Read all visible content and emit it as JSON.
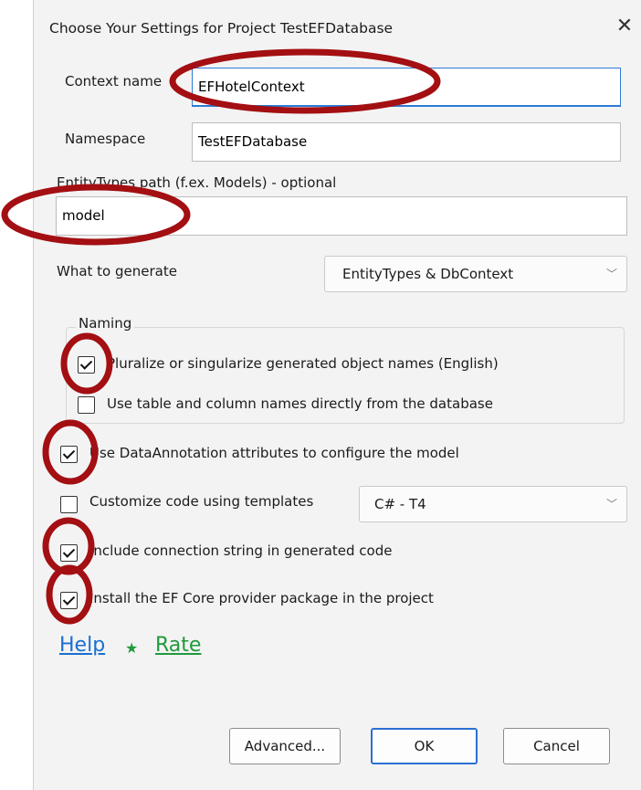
{
  "dialog": {
    "title": "Choose Your Settings for Project TestEFDatabase",
    "close_glyph": "✕"
  },
  "context_name": {
    "label": "Context name",
    "value": "EFHotelContext"
  },
  "namespace": {
    "label": "Namespace",
    "value": "TestEFDatabase"
  },
  "entity_path": {
    "label": "EntityTypes path (f.ex. Models) - optional",
    "value": "model"
  },
  "generate": {
    "label": "What to generate",
    "selected": "EntityTypes & DbContext"
  },
  "naming": {
    "title": "Naming",
    "pluralize": {
      "label": "Pluralize or singularize generated object names (English)",
      "checked": true
    },
    "use_db_names": {
      "label": "Use table and column names directly from the database",
      "checked": false
    }
  },
  "data_annotations": {
    "label": "Use DataAnnotation attributes to configure the model",
    "checked": true
  },
  "templates": {
    "label": "Customize code using templates",
    "checked": false,
    "selected": "C# - T4"
  },
  "connection_string": {
    "label": "Include connection string in generated code",
    "checked": true
  },
  "install_provider": {
    "label": "Install the EF Core provider package in the project",
    "checked": true
  },
  "links": {
    "help": "Help",
    "star": "★",
    "rate": "Rate"
  },
  "buttons": {
    "advanced": "Advanced...",
    "ok": "OK",
    "cancel": "Cancel"
  },
  "colors": {
    "annotation": "#a30f12",
    "link_help": "#1a6fd0",
    "link_rate": "#1f9a3a",
    "focus": "#2c7ad6"
  }
}
